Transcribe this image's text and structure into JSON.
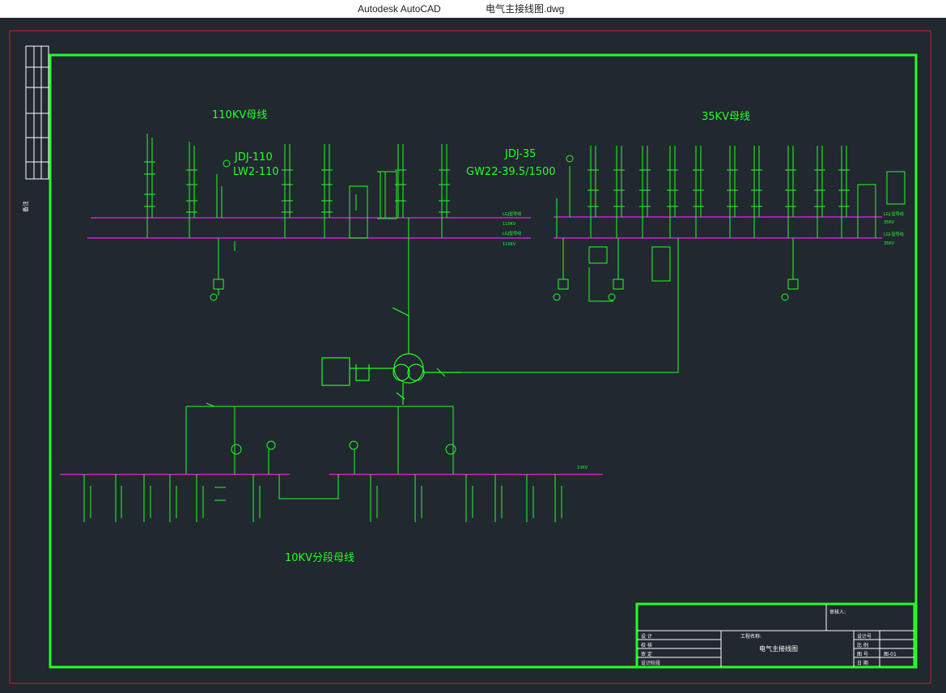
{
  "window": {
    "app_title": "Autodesk AutoCAD",
    "file_name": "电气主接线图.dwg"
  },
  "colors": {
    "background": "#212830",
    "line": "#22ff22",
    "bus": "#cc22cc",
    "frame": "#cc2222",
    "text": "#22ff22"
  },
  "drawing": {
    "label_110kv": "110KV母线",
    "label_35kv": "35KV母线",
    "label_10kv": "10KV分段母线",
    "ct_110": "JDJ-110",
    "breaker_110": "LW2-110",
    "ct_35": "JDJ-35",
    "switch_35": "GW22-39.5/1500",
    "bus_110_upper": "LGJ型导线",
    "bus_110_upper_v": "110KV",
    "bus_110_lower": "LGJ型导线",
    "bus_110_lower_v": "110KV",
    "bus_35_upper": "LGJ-型导线",
    "bus_35_upper_v": "35KV",
    "bus_35_lower": "LGJ-型导线",
    "bus_35_lower_v": "35KV",
    "bus_10_label": "10KV",
    "side_label": "备注"
  },
  "title_block": {
    "approved_label": "审核人:",
    "project_label": "工程名称:",
    "drawing_title": "电气主接线图",
    "rows_left": [
      "设 计",
      "校 核",
      "审 定",
      "设计阶段"
    ],
    "rows_right": [
      "设计号",
      "比 例",
      "图 号",
      "日 期"
    ],
    "right_values": [
      "",
      "",
      "图-01",
      ""
    ]
  }
}
